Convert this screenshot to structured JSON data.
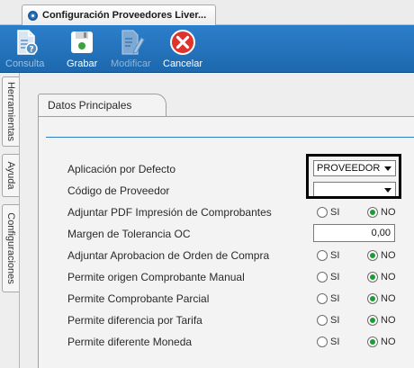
{
  "window": {
    "tab_title": "Configuración Proveedores Liver...",
    "tab_icon": "module-icon"
  },
  "toolbar": {
    "buttons": [
      {
        "label": "Consulta",
        "icon": "consult-document-icon",
        "enabled": true
      },
      {
        "label": "Grabar",
        "icon": "floppy-disk-icon",
        "enabled": true
      },
      {
        "label": "Modificar",
        "icon": "edit-document-icon",
        "enabled": false
      },
      {
        "label": "Cancelar",
        "icon": "cancel-x-icon",
        "enabled": true
      }
    ]
  },
  "side_tabs": [
    "Herramientas",
    "Ayuda",
    "Configuraciones"
  ],
  "section_tab": "Datos Principales",
  "form": {
    "aplicacion_defecto": {
      "label": "Aplicación por Defecto",
      "value": "PROVEEDOR"
    },
    "codigo_proveedor": {
      "label": "Código de Proveedor",
      "value": ""
    },
    "adjuntar_pdf": {
      "label": "Adjuntar PDF Impresión de Comprobantes",
      "si": "SI",
      "no": "NO",
      "selected": "NO"
    },
    "margen_tolerancia": {
      "label": "Margen de Tolerancia OC",
      "value": "0,00"
    },
    "adjuntar_aprobacion": {
      "label": "Adjuntar Aprobacion de Orden de Compra",
      "si": "SI",
      "no": "NO",
      "selected": "NO"
    },
    "origen_manual": {
      "label": "Permite origen Comprobante Manual",
      "si": "SI",
      "no": "NO",
      "selected": "NO"
    },
    "comprobante_parcial": {
      "label": "Permite Comprobante Parcial",
      "si": "SI",
      "no": "NO",
      "selected": "NO"
    },
    "diferencia_tarifa": {
      "label": "Permite diferencia por Tarifa",
      "si": "SI",
      "no": "NO",
      "selected": "NO"
    },
    "diferente_moneda": {
      "label": "Permite diferente Moneda",
      "si": "SI",
      "no": "NO",
      "selected": "NO"
    }
  },
  "colors": {
    "toolbar_blue": "#1d68ae",
    "accent_line": "#2d7cc4",
    "radio_selected": "#1c9c33",
    "cancel_red": "#e0332b"
  }
}
